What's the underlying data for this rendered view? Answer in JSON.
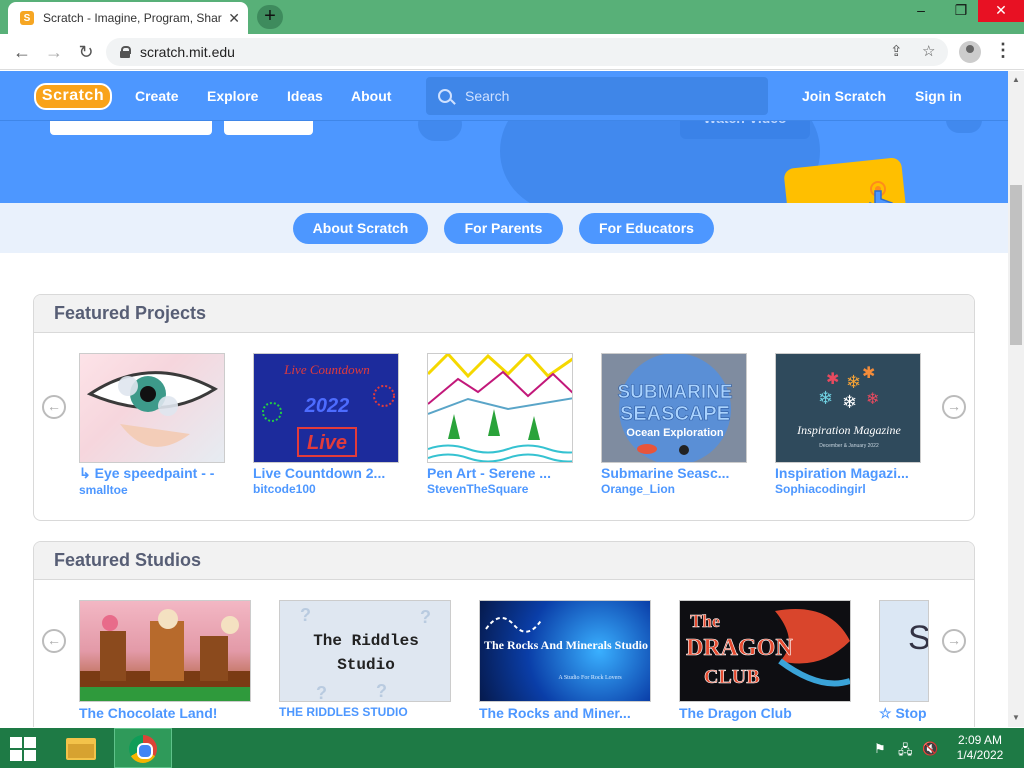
{
  "browser": {
    "tab_title": "Scratch - Imagine, Program, Shar",
    "favicon_letter": "S",
    "url": "scratch.mit.edu",
    "new_tab_icon": "+",
    "window_controls": {
      "minimize": "–",
      "restore": "❐",
      "close": "✕"
    }
  },
  "nav": {
    "logo_text": "Scratch",
    "create": "Create",
    "explore": "Explore",
    "ideas": "Ideas",
    "about": "About",
    "search_placeholder": "Search",
    "join": "Join Scratch",
    "signin": "Sign in"
  },
  "hero": {
    "watch_video": "Watch Video"
  },
  "subnav": {
    "about_scratch": "About Scratch",
    "for_parents": "For Parents",
    "for_educators": "For Educators"
  },
  "featured_projects": {
    "heading": "Featured Projects",
    "items": [
      {
        "title": "↳ Eye speedpaint - -",
        "author": "smalltoe"
      },
      {
        "title": "Live Countdown 2...",
        "author": "bitcode100"
      },
      {
        "title": "Pen Art - Serene ...",
        "author": "StevenTheSquare"
      },
      {
        "title": "Submarine Seasc...",
        "author": "Orange_Lion"
      },
      {
        "title": "Inspiration Magazi...",
        "author": "Sophiacodingirl"
      }
    ],
    "thumb_text": {
      "countdown_top": "Live Countdown",
      "countdown_year": "2022",
      "countdown_live": "Live",
      "sub_line1": "SUBMARINE",
      "sub_line2": "SEASCAPE",
      "sub_line3": "Ocean Exploration",
      "mag_title": "Inspiration Magazine",
      "mag_sub": "December & January 2022"
    }
  },
  "featured_studios": {
    "heading": "Featured Studios",
    "items": [
      {
        "title": "The Chocolate Land!"
      },
      {
        "title": "THE RIDDLES STUDIO"
      },
      {
        "title": "The Rocks and Miner..."
      },
      {
        "title": "The Dragon Club"
      },
      {
        "title": "☆ Stop"
      }
    ],
    "thumb_text": {
      "riddles_line1": "The Riddles",
      "riddles_line2": "Studio",
      "rocks_title": "The Rocks And Minerals Studio",
      "rocks_sub": "A Studio For Rock Lovers",
      "dragon_the": "The",
      "dragon_name": "DRAGON",
      "dragon_club": "CLUB",
      "stop_letters": "S M"
    }
  },
  "taskbar": {
    "time": "2:09 AM",
    "date": "1/4/2022"
  },
  "colors": {
    "scratch_blue": "#4d97ff",
    "scratch_orange": "#f9a31a",
    "taskbar_green": "#1e7a45",
    "tabstrip_green": "#58b078"
  }
}
